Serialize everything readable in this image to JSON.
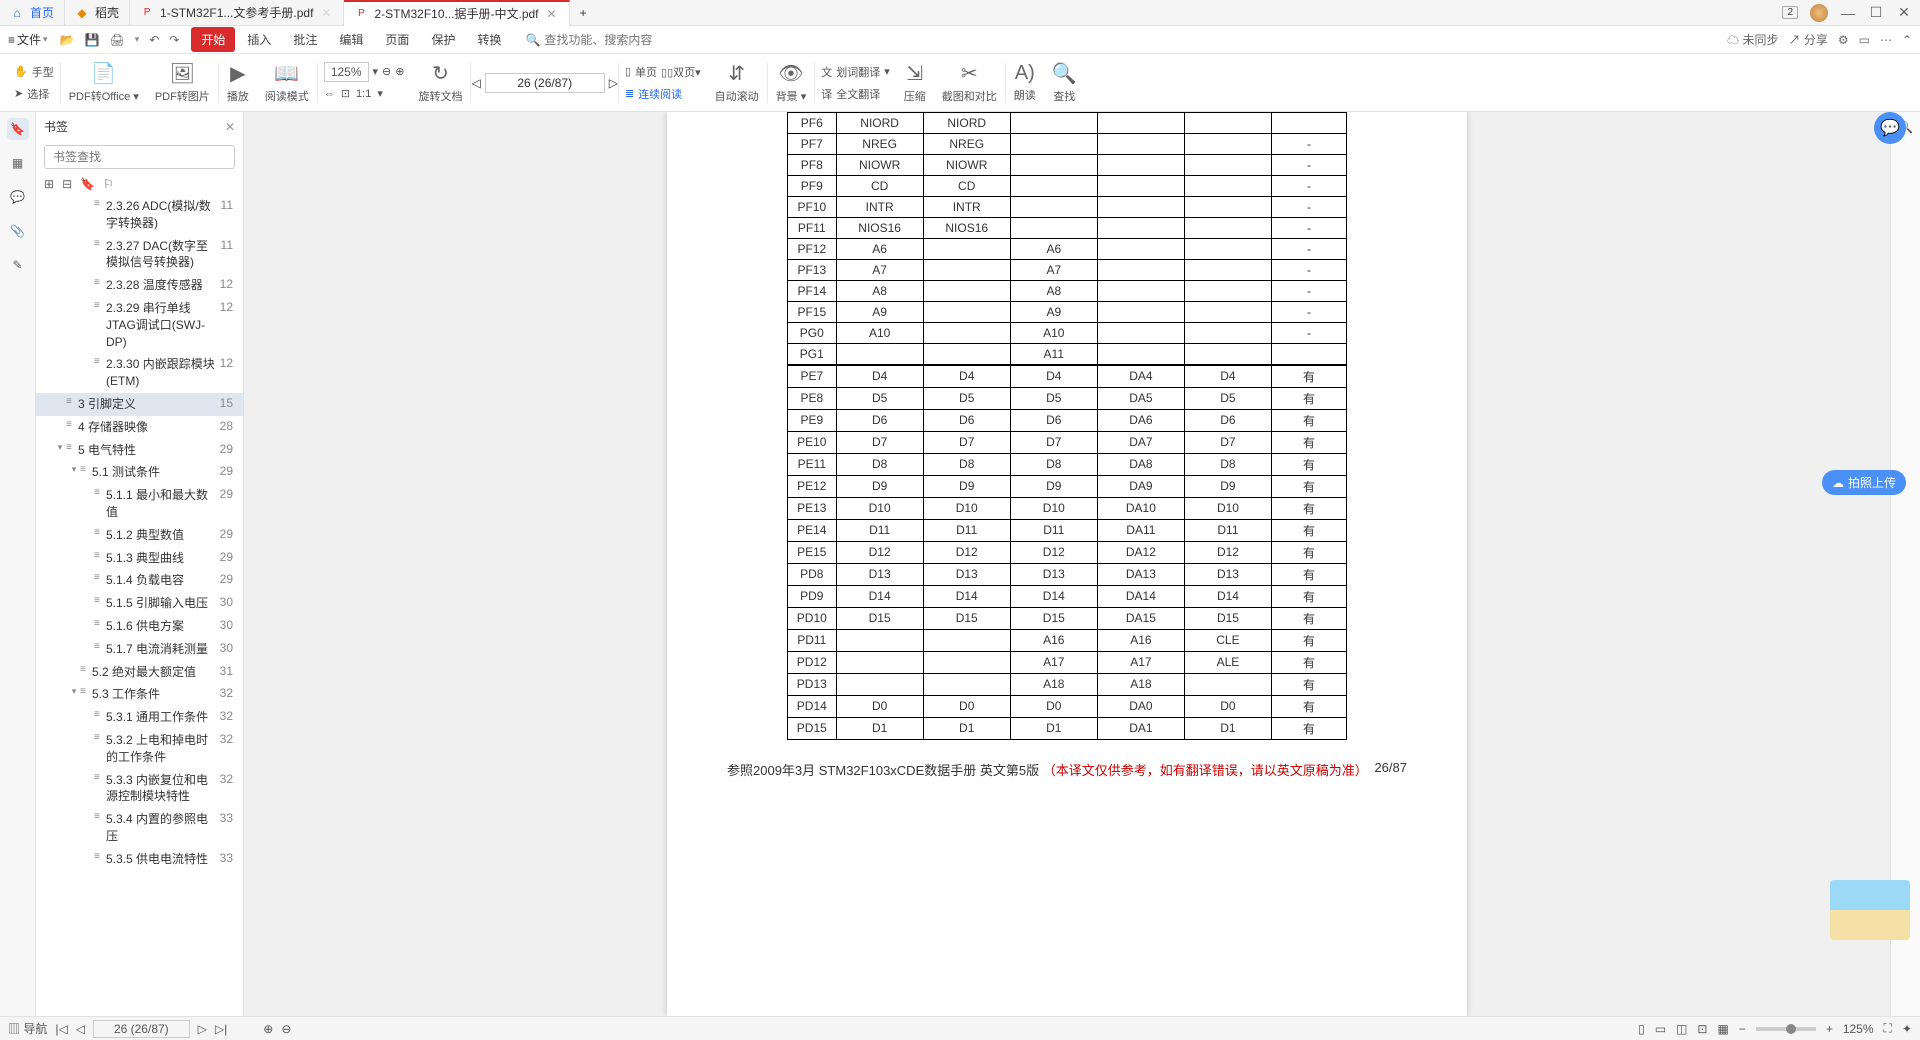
{
  "titlebar": {
    "tabs": [
      {
        "label": "首页",
        "icon": "home"
      },
      {
        "label": "稻壳",
        "icon": "rice"
      },
      {
        "label": "1-STM32F1...文参考手册.pdf",
        "icon": "pdf"
      },
      {
        "label": "2-STM32F10...据手册-中文.pdf",
        "icon": "pdf",
        "active": true
      }
    ],
    "badge": "2"
  },
  "menubar": {
    "file": "文件",
    "tabs": [
      "开始",
      "插入",
      "批注",
      "编辑",
      "页面",
      "保护",
      "转换"
    ],
    "active_tab": "开始",
    "search_placeholder": "查找功能、搜索内容",
    "sync": "未同步",
    "share": "分享"
  },
  "ribbon": {
    "hand": "手型",
    "select": "选择",
    "pdf2office": "PDF转Office",
    "pdf2img": "PDF转图片",
    "play": "播放",
    "readmode": "阅读模式",
    "zoom": "125%",
    "rotate": "旋转文档",
    "page_input": "26 (26/87)",
    "single": "单页",
    "double": "双页",
    "continuous": "连续阅读",
    "autoscroll": "自动滚动",
    "bg": "背景",
    "wordtrans": "划词翻译",
    "fulltrans": "全文翻译",
    "compress": "压缩",
    "screenshot": "截图和对比",
    "readaloud": "朗读",
    "find": "查找"
  },
  "bookmark": {
    "title": "书签",
    "search_placeholder": "书签查找",
    "items": [
      {
        "indent": 3,
        "label": "2.3.26 ADC(模拟/数字转换器)",
        "page": 11
      },
      {
        "indent": 3,
        "label": "2.3.27 DAC(数字至模拟信号转换器)",
        "page": 11
      },
      {
        "indent": 3,
        "label": "2.3.28 温度传感器",
        "page": 12
      },
      {
        "indent": 3,
        "label": "2.3.29 串行单线JTAG调试口(SWJ-DP)",
        "page": 12
      },
      {
        "indent": 3,
        "label": "2.3.30 内嵌跟踪模块(ETM)",
        "page": 12
      },
      {
        "indent": 1,
        "label": "3 引脚定义",
        "page": 15,
        "selected": true
      },
      {
        "indent": 1,
        "label": "4 存储器映像",
        "page": 28
      },
      {
        "indent": 1,
        "label": "5 电气特性",
        "page": 29,
        "expandable": true,
        "open": true
      },
      {
        "indent": 2,
        "label": "5.1 测试条件",
        "page": 29,
        "expandable": true,
        "open": true
      },
      {
        "indent": 3,
        "label": "5.1.1 最小和最大数值",
        "page": 29
      },
      {
        "indent": 3,
        "label": "5.1.2 典型数值",
        "page": 29
      },
      {
        "indent": 3,
        "label": "5.1.3 典型曲线",
        "page": 29
      },
      {
        "indent": 3,
        "label": "5.1.4 负载电容",
        "page": 29
      },
      {
        "indent": 3,
        "label": "5.1.5 引脚输入电压",
        "page": 30
      },
      {
        "indent": 3,
        "label": "5.1.6 供电方案",
        "page": 30
      },
      {
        "indent": 3,
        "label": "5.1.7 电流消耗测量",
        "page": 30
      },
      {
        "indent": 2,
        "label": "5.2 绝对最大额定值",
        "page": 31
      },
      {
        "indent": 2,
        "label": "5.3 工作条件",
        "page": 32,
        "expandable": true,
        "open": true
      },
      {
        "indent": 3,
        "label": "5.3.1 通用工作条件",
        "page": 32
      },
      {
        "indent": 3,
        "label": "5.3.2 上电和掉电时的工作条件",
        "page": 32
      },
      {
        "indent": 3,
        "label": "5.3.3 内嵌复位和电源控制模块特性",
        "page": 32
      },
      {
        "indent": 3,
        "label": "5.3.4 内置的参照电压",
        "page": 33
      },
      {
        "indent": 3,
        "label": "5.3.5 供电电流特性",
        "page": 33
      }
    ]
  },
  "table": {
    "rows": [
      [
        "PF6",
        "NIORD",
        "NIORD",
        "",
        "",
        "",
        ""
      ],
      [
        "PF7",
        "NREG",
        "NREG",
        "",
        "",
        "",
        "-"
      ],
      [
        "PF8",
        "NIOWR",
        "NIOWR",
        "",
        "",
        "",
        "-"
      ],
      [
        "PF9",
        "CD",
        "CD",
        "",
        "",
        "",
        "-"
      ],
      [
        "PF10",
        "INTR",
        "INTR",
        "",
        "",
        "",
        "-"
      ],
      [
        "PF11",
        "NIOS16",
        "NIOS16",
        "",
        "",
        "",
        "-"
      ],
      [
        "PF12",
        "A6",
        "",
        "A6",
        "",
        "",
        "-"
      ],
      [
        "PF13",
        "A7",
        "",
        "A7",
        "",
        "",
        "-"
      ],
      [
        "PF14",
        "A8",
        "",
        "A8",
        "",
        "",
        "-"
      ],
      [
        "PF15",
        "A9",
        "",
        "A9",
        "",
        "",
        "-"
      ],
      [
        "PG0",
        "A10",
        "",
        "A10",
        "",
        "",
        "-"
      ],
      [
        "PG1",
        "",
        "",
        "A11",
        "",
        "",
        ""
      ],
      [
        "PE7",
        "D4",
        "D4",
        "D4",
        "DA4",
        "D4",
        "有"
      ],
      [
        "PE8",
        "D5",
        "D5",
        "D5",
        "DA5",
        "D5",
        "有"
      ],
      [
        "PE9",
        "D6",
        "D6",
        "D6",
        "DA6",
        "D6",
        "有"
      ],
      [
        "PE10",
        "D7",
        "D7",
        "D7",
        "DA7",
        "D7",
        "有"
      ],
      [
        "PE11",
        "D8",
        "D8",
        "D8",
        "DA8",
        "D8",
        "有"
      ],
      [
        "PE12",
        "D9",
        "D9",
        "D9",
        "DA9",
        "D9",
        "有"
      ],
      [
        "PE13",
        "D10",
        "D10",
        "D10",
        "DA10",
        "D10",
        "有"
      ],
      [
        "PE14",
        "D11",
        "D11",
        "D11",
        "DA11",
        "D11",
        "有"
      ],
      [
        "PE15",
        "D12",
        "D12",
        "D12",
        "DA12",
        "D12",
        "有"
      ],
      [
        "PD8",
        "D13",
        "D13",
        "D13",
        "DA13",
        "D13",
        "有"
      ],
      [
        "PD9",
        "D14",
        "D14",
        "D14",
        "DA14",
        "D14",
        "有"
      ],
      [
        "PD10",
        "D15",
        "D15",
        "D15",
        "DA15",
        "D15",
        "有"
      ],
      [
        "PD11",
        "",
        "",
        "A16",
        "A16",
        "CLE",
        "有"
      ],
      [
        "PD12",
        "",
        "",
        "A17",
        "A17",
        "ALE",
        "有"
      ],
      [
        "PD13",
        "",
        "",
        "A18",
        "A18",
        "",
        "有"
      ],
      [
        "PD14",
        "D0",
        "D0",
        "D0",
        "DA0",
        "D0",
        "有"
      ],
      [
        "PD15",
        "D1",
        "D1",
        "D1",
        "DA1",
        "D1",
        "有"
      ]
    ],
    "thick_after": [
      11
    ],
    "footer_left": "参照2009年3月 STM32F103xCDE数据手册 英文第5版",
    "footer_red": "（本译文仅供参考，如有翻译错误，请以英文原稿为准）",
    "footer_right": "26/87"
  },
  "status": {
    "nav": "导航",
    "page": "26 (26/87)",
    "zoom": "125%"
  },
  "float": {
    "upload": "拍照上传"
  }
}
